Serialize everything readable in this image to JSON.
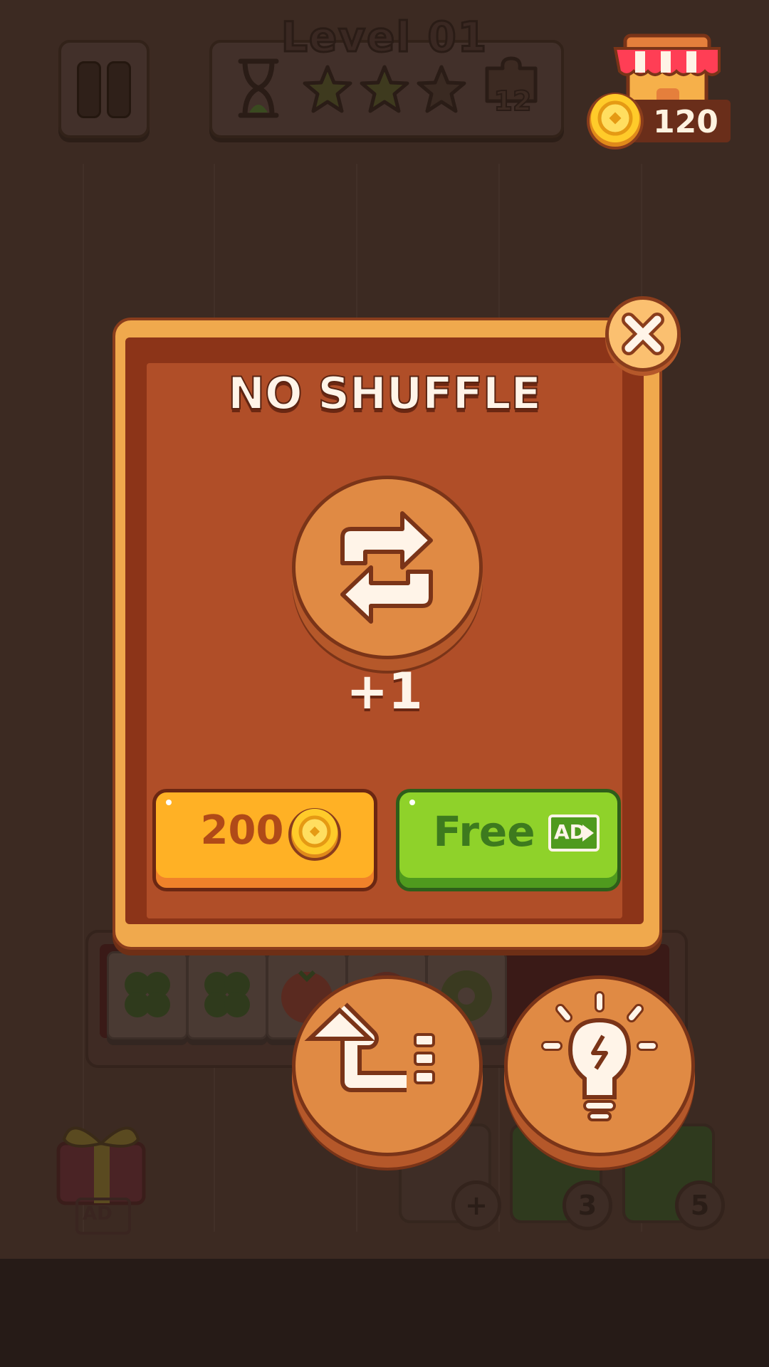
{
  "header": {
    "level_title": "Level 01",
    "moves_count": "12",
    "coins": "120"
  },
  "dialog": {
    "title": "NO SHUFFLE",
    "reward": "+1",
    "buy_price": "200",
    "free_label": "Free",
    "ad_badge": "AD"
  },
  "bottom_bar": {
    "undo_badge": "+",
    "hint_count": "3",
    "shuffle_count": "5",
    "gift_ad_badge": "AD"
  },
  "icons": {
    "pause": "pause-icon",
    "timer": "hourglass-icon",
    "stars": [
      "star-icon",
      "star-icon",
      "star-icon"
    ],
    "moves": "puzzle-icon",
    "shop": "shop-icon",
    "coin": "coin-icon",
    "close": "close-icon",
    "shuffle": "shuffle-icon",
    "undo": "undo-icon",
    "hint": "lightbulb-icon",
    "gift": "gift-icon",
    "tiles": [
      "clover-icon",
      "clover-icon",
      "tomato-icon",
      "tomato-icon",
      "donut-icon"
    ]
  },
  "colors": {
    "dialog_frame": "#f0a94d",
    "dialog_inner": "#b04e28",
    "buy_button": "#ffb125",
    "free_button": "#8fd22a",
    "coin": "#ffcb2a"
  }
}
